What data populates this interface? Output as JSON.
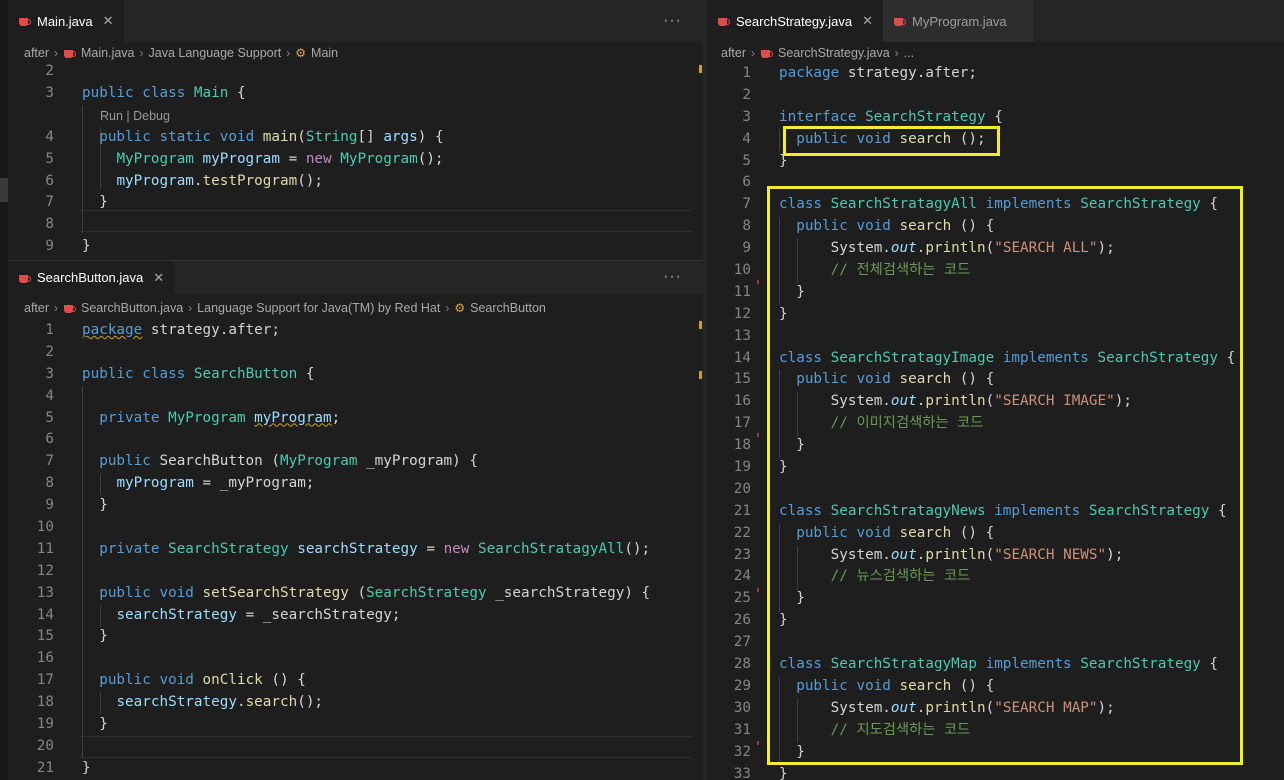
{
  "main": {
    "tab": "Main.java",
    "breadcrumb": [
      "after",
      "Main.java",
      "Java Language Support",
      "Main"
    ],
    "codelens": "Run | Debug"
  },
  "searchbutton": {
    "tab": "SearchButton.java",
    "breadcrumb": [
      "after",
      "SearchButton.java",
      "Language Support for Java(TM) by Red Hat",
      "SearchButton"
    ]
  },
  "strategy": {
    "tab_active": "SearchStrategy.java",
    "tab_other": "MyProgram.java",
    "breadcrumb": [
      "after",
      "SearchStrategy.java",
      "..."
    ]
  },
  "colors": {
    "highlight": "#f2ee2c",
    "java_icon": "#e24b4b"
  }
}
